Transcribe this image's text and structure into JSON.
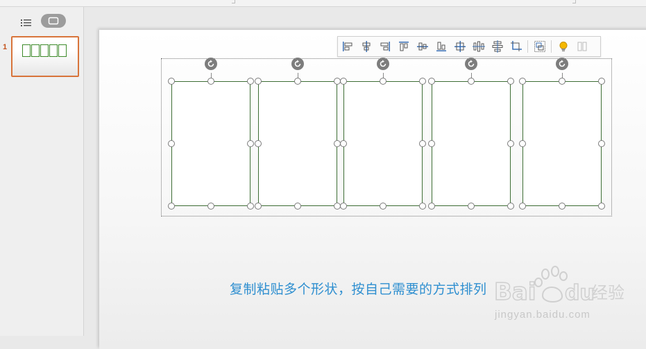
{
  "slide_panel": {
    "slide_number": "1"
  },
  "caption": "复制粘贴多个形状，按自己需要的方式排列",
  "toolbar": {
    "buttons": [
      "align-left-icon",
      "align-center-icon",
      "align-right-icon",
      "align-top-icon",
      "align-middle-icon",
      "align-bottom-icon",
      "align-center-both-icon",
      "distribute-horizontal-icon",
      "distribute-vertical-icon",
      "crop-icon",
      "group-icon",
      "lightbulb-icon",
      "more-icon"
    ]
  },
  "watermark": {
    "brand": "Bai du 经验",
    "url": "jingyan.baidu.com"
  },
  "colors": {
    "shape_border": "#3e6e35",
    "caption": "#2f8fd0",
    "thumbnail_border": "#d8743a"
  }
}
